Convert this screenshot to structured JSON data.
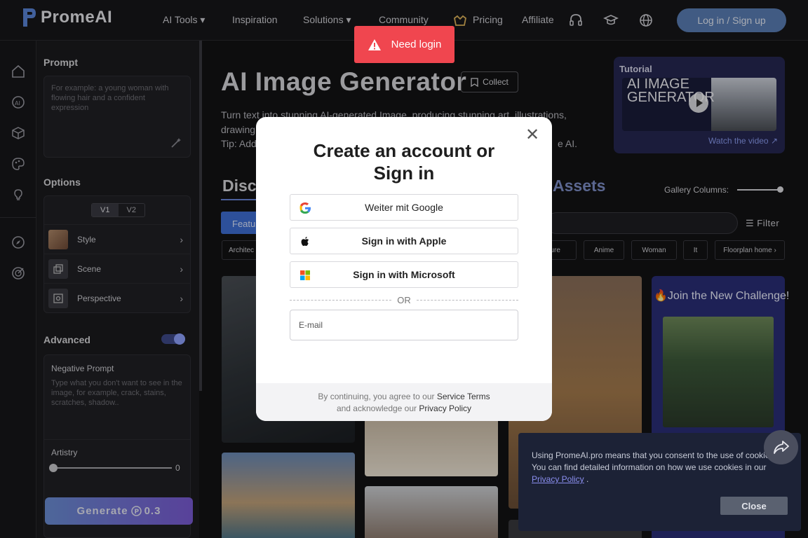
{
  "header": {
    "logo_text": "PromeAI",
    "nav": [
      "AI Tools",
      "Inspiration",
      "Solutions",
      "Community",
      "Pricing",
      "Affiliate"
    ],
    "login_label": "Log in / Sign up"
  },
  "left_panel": {
    "prompt_title": "Prompt",
    "prompt_placeholder": "For example: a young woman with flowing hair and a confident expression",
    "options_title": "Options",
    "version_v1": "V1",
    "version_v2": "V2",
    "options": [
      {
        "label": "Style"
      },
      {
        "label": "Scene"
      },
      {
        "label": "Perspective"
      }
    ],
    "advanced_title": "Advanced",
    "negative_title": "Negative Prompt",
    "negative_placeholder": "Type what you don't want to see in the image, for example, crack, stains, scratches, shadow..",
    "artistry_label": "Artistry",
    "artistry_value": "0",
    "generate_label": "Generate",
    "generate_cost": "0.3"
  },
  "main": {
    "title": "AI Image Generator",
    "collect_label": "Collect",
    "desc_line1": "Turn text into stunning AI-generated Image, producing stunning art, illustrations,",
    "desc_line2": "drawing",
    "tip_start": "Tip: Add",
    "tip_end": "e AI.",
    "tutorial_title": "Tutorial",
    "tutorial_video_text": "AI IMAGE GENERATOR",
    "tutorial_link": "Watch the video",
    "tab_discover": "Disc",
    "tab_assets": "Assets",
    "gallery_columns_label": "Gallery Columns:",
    "featured_label": "Featu",
    "filter_label": "Filter",
    "chips": [
      "Architec",
      "ecture",
      "Anime",
      "Woman",
      "It",
      "Floorplan home"
    ],
    "challenge_title": "🔥Join the New Challenge!"
  },
  "toast": {
    "text": "Need login"
  },
  "modal": {
    "title_line1": "Create an account or",
    "title_line2": "Sign in",
    "google_label": "Weiter mit Google",
    "apple_label": "Sign in with Apple",
    "microsoft_label": "Sign in with Microsoft",
    "or_label": "OR",
    "email_placeholder": "E-mail",
    "footer_prefix": "By continuing, you agree to our",
    "service_terms": "Service Terms",
    "footer_mid": "and acknowledge our",
    "privacy_policy": "Privacy Policy"
  },
  "cookie": {
    "text": "Using PromeAI.pro means that you consent to the use of cookies. You can find detailed information on how we use cookies in our",
    "link": "Privacy Policy",
    "close_label": "Close"
  }
}
